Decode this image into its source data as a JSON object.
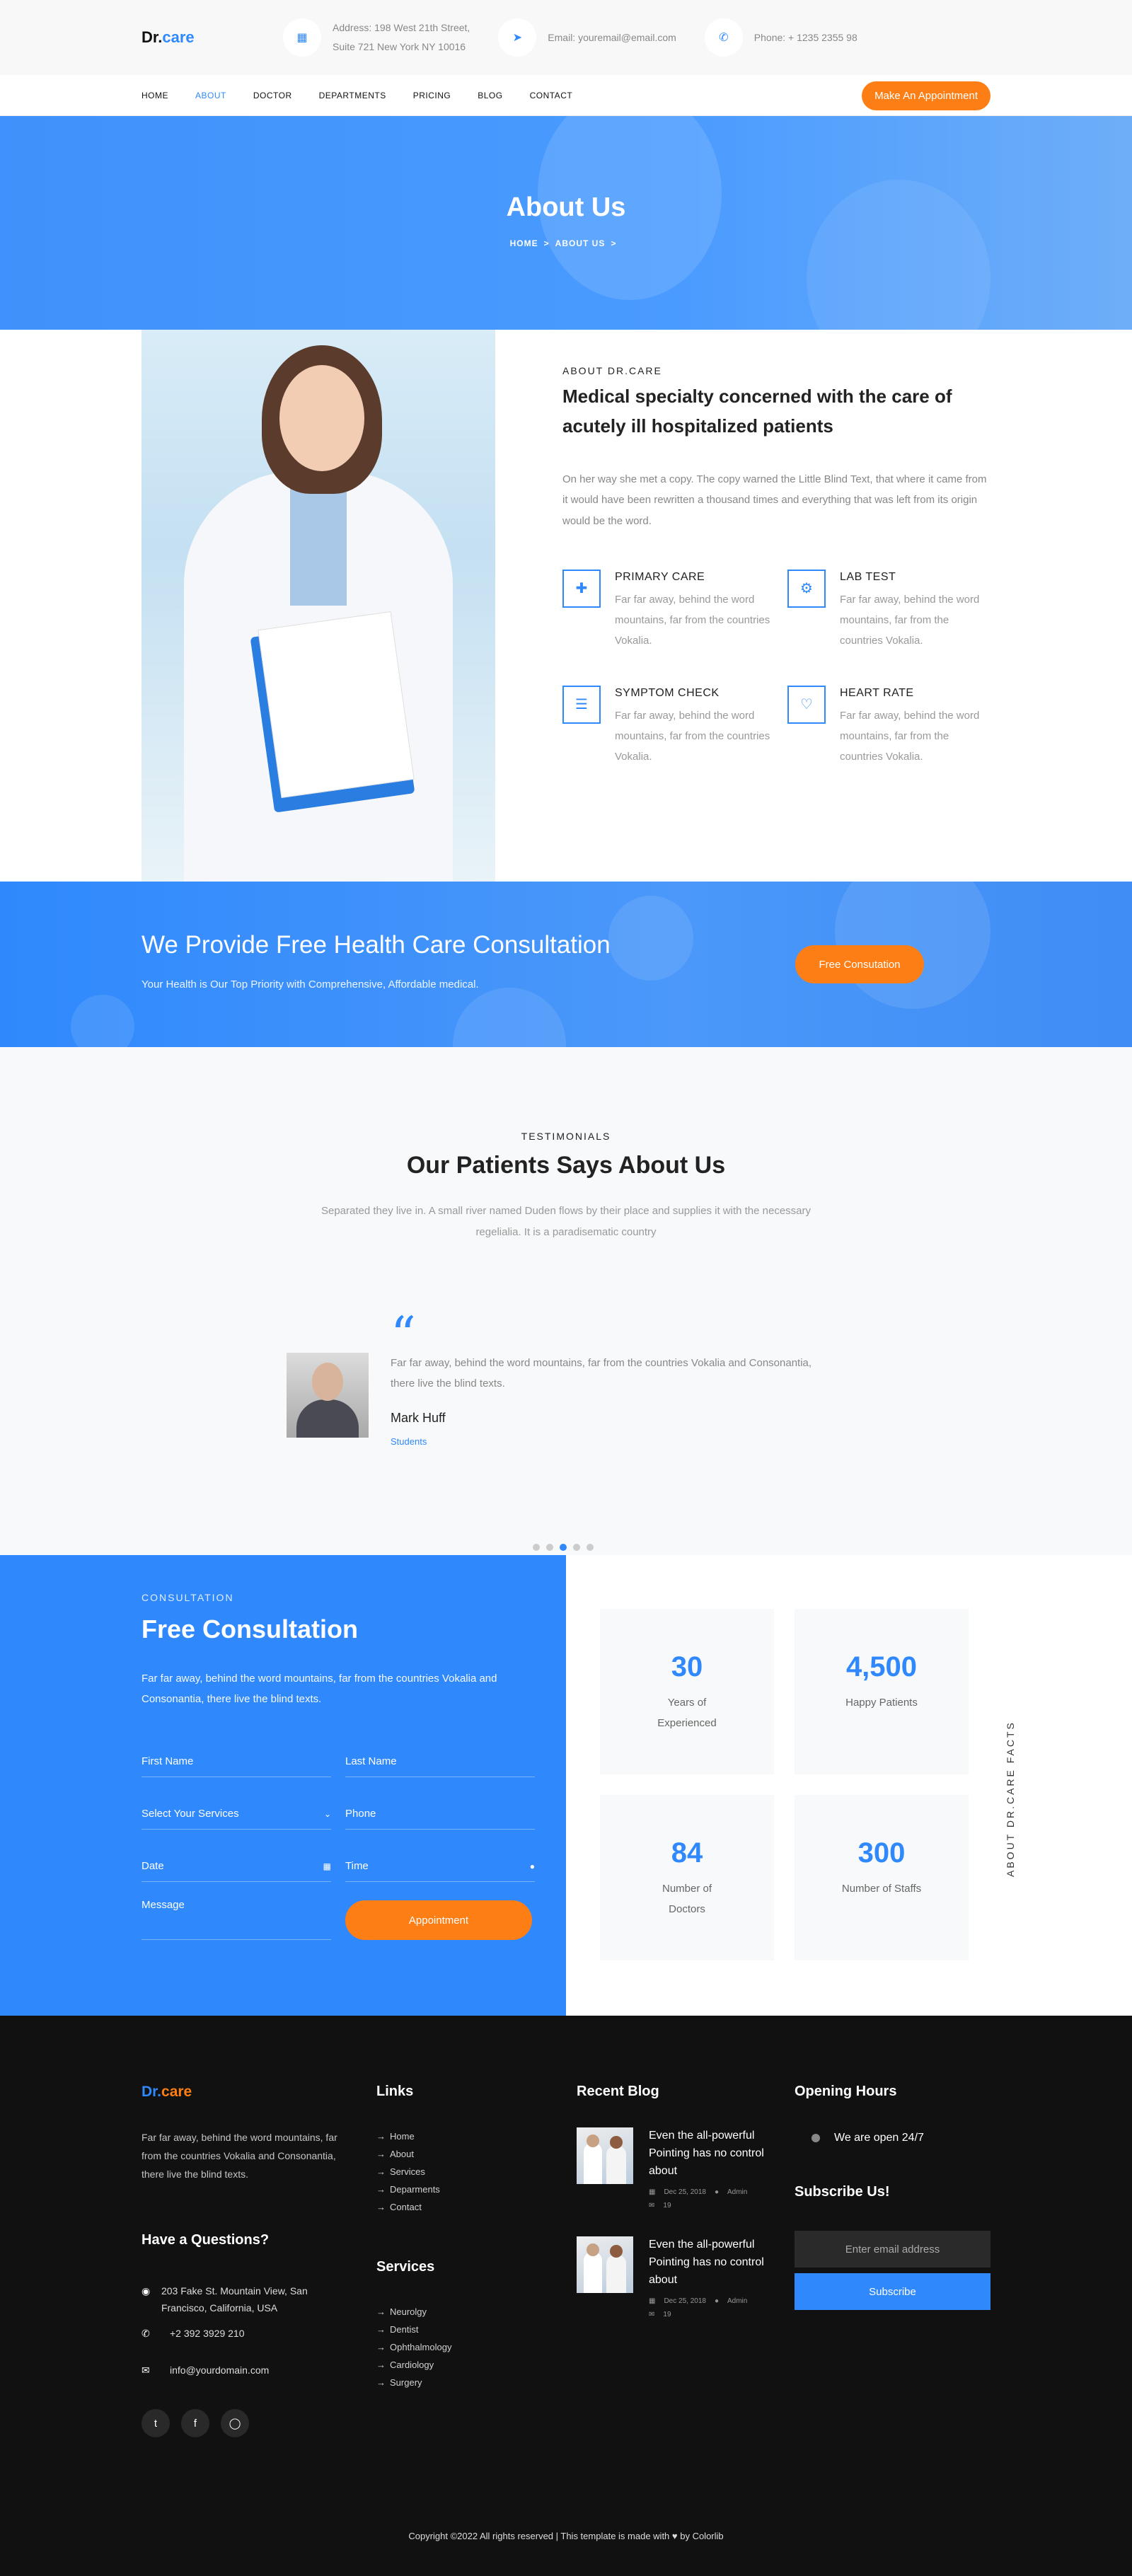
{
  "brand": {
    "logo_dr": "Dr.",
    "logo_care": "care"
  },
  "topbar": {
    "address_line1": "Address: 198 West 21th Street,",
    "address_line2": "Suite 721 New York NY 10016",
    "email": "Email: youremail@email.com",
    "phone": "Phone: + 1235 2355 98"
  },
  "nav": {
    "items": [
      "HOME",
      "ABOUT",
      "DOCTOR",
      "DEPARTMENTS",
      "PRICING",
      "BLOG",
      "CONTACT"
    ],
    "active": "ABOUT",
    "appointment_button": "Make An Appointment"
  },
  "hero": {
    "title": "About Us",
    "crumb_home": "HOME",
    "crumb_current": "ABOUT US",
    "crumb_sep": ">"
  },
  "about": {
    "subheading": "ABOUT DR.CARE",
    "heading": "Medical specialty concerned with the care of acutely ill hospitalized patients",
    "lead": "On her way she met a copy. The copy warned the Little Blind Text, that where it came from it would have been rewritten a thousand times and everything that was left from its origin would be the word.",
    "services": [
      {
        "title": "PRIMARY CARE",
        "text": "Far far away, behind the word mountains, far from the countries Vokalia.",
        "icon": "first-aid-kit-icon"
      },
      {
        "title": "LAB TEST",
        "text": "Far far away, behind the word mountains, far from the countries Vokalia.",
        "icon": "syringe-icon"
      },
      {
        "title": "SYMPTOM CHECK",
        "text": "Far far away, behind the word mountains, far from the countries Vokalia.",
        "icon": "clipboard-icon"
      },
      {
        "title": "HEART RATE",
        "text": "Far far away, behind the word mountains, far from the countries Vokalia.",
        "icon": "heart-rate-icon"
      }
    ]
  },
  "cta": {
    "title": "We Provide Free Health Care Consultation",
    "subtitle": "Your Health is Our Top Priority with Comprehensive, Affordable medical.",
    "button": "Free Consutation"
  },
  "testimonials": {
    "subheading": "TESTIMONIALS",
    "title": "Our Patients Says About Us",
    "intro": "Separated they live in. A small river named Duden flows by their place and supplies it with the necessary regelialia. It is a paradisematic country",
    "quote_mark": "“",
    "text": "Far far away, behind the word mountains, far from the countries Vokalia and Consonantia, there live the blind texts.",
    "name": "Mark Huff",
    "position": "Students",
    "active_dot": 2,
    "dot_count": 5
  },
  "consultation": {
    "subheading": "CONSULTATION",
    "title": "Free Consultation",
    "text": "Far far away, behind the word mountains, far from the countries Vokalia and Consonantia, there live the blind texts.",
    "first_name": "First Name",
    "last_name": "Last Name",
    "services_select": "Select Your Services",
    "phone": "Phone",
    "date": "Date",
    "time": "Time",
    "message": "Message",
    "button": "Appointment"
  },
  "facts": {
    "vertical_label": "ABOUT DR.CARE FACTS",
    "items": [
      {
        "number": "30",
        "label": "Years of Experienced"
      },
      {
        "number": "4,500",
        "label": "Happy Patients"
      },
      {
        "number": "84",
        "label": "Number of Doctors"
      },
      {
        "number": "300",
        "label": "Number of Staffs"
      }
    ]
  },
  "footer": {
    "logo_dr": "Dr.",
    "logo_care": "care",
    "about": "Far far away, behind the word mountains, far from the countries Vokalia and Consonantia, there live the blind texts.",
    "questions_title": "Have a Questions?",
    "address": "203 Fake St. Mountain View, San Francisco, California, USA",
    "phone": "+2 392 3929 210",
    "email": "info@yourdomain.com",
    "links_title": "Links",
    "links": [
      "Home",
      "About",
      "Services",
      "Deparments",
      "Contact"
    ],
    "services_title": "Services",
    "services": [
      "Neurolgy",
      "Dentist",
      "Ophthalmology",
      "Cardiology",
      "Surgery"
    ],
    "blog_title": "Recent Blog",
    "blog": [
      {
        "title": "Even the all-powerful Pointing has no control about",
        "date": "Dec 25, 2018",
        "author": "Admin",
        "comments": "19"
      },
      {
        "title": "Even the all-powerful Pointing has no control about",
        "date": "Dec 25, 2018",
        "author": "Admin",
        "comments": "19"
      }
    ],
    "hours_title": "Opening Hours",
    "hours": "We are open 24/7",
    "subscribe_title": "Subscribe Us!",
    "subscribe_placeholder": "Enter email address",
    "subscribe_button": "Subscribe",
    "copyright": "Copyright ©2022 All rights reserved | This template is made with ♥ by Colorlib"
  },
  "colors": {
    "primary": "#2f89fc",
    "accent": "#fd7e14",
    "footer_bg": "#111111"
  }
}
